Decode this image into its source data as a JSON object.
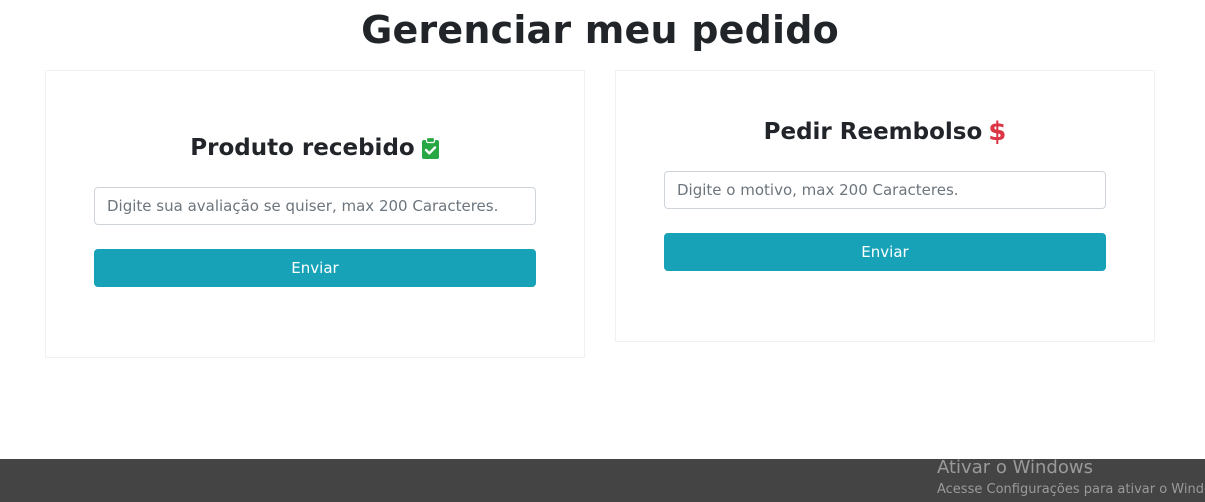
{
  "page": {
    "title": "Gerenciar meu pedido"
  },
  "received_card": {
    "title": "Produto recebido",
    "icon": "clipboard-check-icon",
    "icon_color": "#28a745",
    "review_placeholder": "Digite sua avaliação se quiser, max 200 Caracteres.",
    "review_value": "",
    "submit_label": "Enviar"
  },
  "refund_card": {
    "title": "Pedir Reembolso",
    "icon": "dollar-sign-icon",
    "icon_symbol": "$",
    "icon_color": "#dc3545",
    "reason_placeholder": "Digite o motivo, max 200 Caracteres.",
    "reason_value": "",
    "submit_label": "Enviar"
  },
  "colors": {
    "accent": "#17a2b8",
    "text": "#212529",
    "taskbar": "#444444"
  },
  "windows_watermark": {
    "title": "Ativar o Windows",
    "subtitle": "Acesse Configurações para ativar o Windows."
  }
}
